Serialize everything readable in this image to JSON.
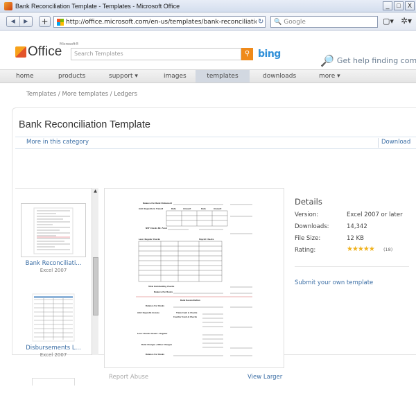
{
  "window": {
    "title": "Bank Reconciliation Template - Templates - Microsoft Office",
    "controls": [
      "_",
      "□",
      "X"
    ]
  },
  "browser": {
    "back": "◀",
    "forward": "▶",
    "new_tab": "+",
    "url": "http://office.microsoft.com/en-us/templates/bank-reconciliation-te",
    "reload": "↻",
    "search_placeholder": "Google",
    "page_menu": "▢▾",
    "tools_menu": "✲▾"
  },
  "header": {
    "logo_text": "Office",
    "logo_super": "Microsoft®",
    "search_placeholder": "Search Templates",
    "search_button": "⚲",
    "bing": "bing",
    "help_text": "Get help finding comm"
  },
  "nav": {
    "items": [
      "home",
      "products",
      "support ▾",
      "images",
      "templates",
      "downloads",
      "more ▾"
    ],
    "active": "templates"
  },
  "breadcrumb": "Templates / More templates / Ledgers",
  "page": {
    "title": "Bank Reconciliation Template",
    "more_in_category": "More in this category",
    "download": "Download"
  },
  "thumbnails": [
    {
      "label": "Bank Reconciliati...",
      "sub": "Excel 2007"
    },
    {
      "label": "Disbursements L...",
      "sub": "Excel 2007"
    }
  ],
  "preview": {
    "report_abuse": "Report Abuse",
    "view_larger": "View Larger",
    "doc_labels": {
      "balance_statement": "Balance Per Bank Statement",
      "add_deposits": "Add: Deposits In Transit",
      "date": "Date",
      "amount": "Amount",
      "nsf": "NSF Checks  Bk. Fund",
      "less_checks": "Less: Regular Checks",
      "payroll": "Payroll Checks",
      "total_outstanding": "Total Outstanding Checks",
      "balance_books": "Balance Per Books",
      "bank_recon": "Bank Reconciliation",
      "balance_per_books2": "Balance Per Books",
      "add_deposits2": "Add: Deposits  Income",
      "trade_cash": "Trade Cash & Checks",
      "counter_cash": "Counter Cash & Checks",
      "less_checks2": "Less: Checks Issued - Regular",
      "misc": "Bank Charges / Other Charges",
      "balance_books3": "Balance Per Books"
    }
  },
  "details": {
    "title": "Details",
    "rows": [
      {
        "label": "Version:",
        "value": "Excel 2007 or later"
      },
      {
        "label": "Downloads:",
        "value": "14,342"
      },
      {
        "label": "File Size:",
        "value": "12 KB"
      },
      {
        "label": "Rating:",
        "value": ""
      }
    ],
    "stars": "★★★★★",
    "rating_count": "(18)",
    "submit_link": "Submit your own template"
  }
}
